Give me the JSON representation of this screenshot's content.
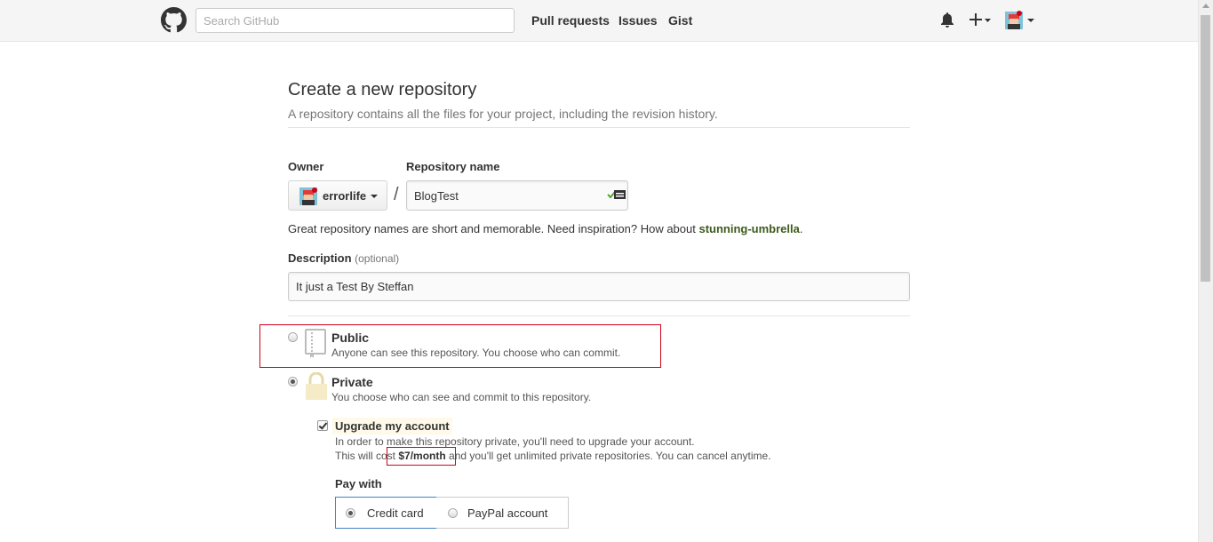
{
  "header": {
    "search_placeholder": "Search GitHub",
    "nav": [
      "Pull requests",
      "Issues",
      "Gist"
    ],
    "icons": [
      "github-logo-icon",
      "bell-icon",
      "plus-icon",
      "avatar-icon"
    ]
  },
  "page": {
    "title": "Create a new repository",
    "subtitle": "A repository contains all the files for your project, including the revision history."
  },
  "form": {
    "owner_label": "Owner",
    "owner_value": "errorlife",
    "repo_label": "Repository name",
    "repo_value": "BlogTest",
    "separator": "/",
    "hint_prefix": "Great repository names are short and memorable. Need inspiration? How about ",
    "hint_suggestion": "stunning-umbrella",
    "hint_suffix": ".",
    "description_label": "Description",
    "description_optional": "(optional)",
    "description_value": "It just a Test By Steffan"
  },
  "visibility": {
    "public_title": "Public",
    "public_desc": "Anyone can see this repository. You choose who can commit.",
    "private_title": "Private",
    "private_desc": "You choose who can see and commit to this repository.",
    "selected": "Private"
  },
  "upgrade": {
    "checkbox_label": "Upgrade my account",
    "checked": true,
    "line1": "In order to make this repository private, you'll need to upgrade your account.",
    "line2_prefix": "This will cost ",
    "price": "$7/month",
    "line2_suffix": " and you'll get unlimited private repositories. You can cancel anytime."
  },
  "payment": {
    "label": "Pay with",
    "options": [
      "Credit card",
      "PayPal account"
    ],
    "selected": "Credit card"
  },
  "colors": {
    "highlight_box": "#d0021b",
    "suggestion": "#3d5a1c",
    "selected_border": "#4183c4"
  }
}
